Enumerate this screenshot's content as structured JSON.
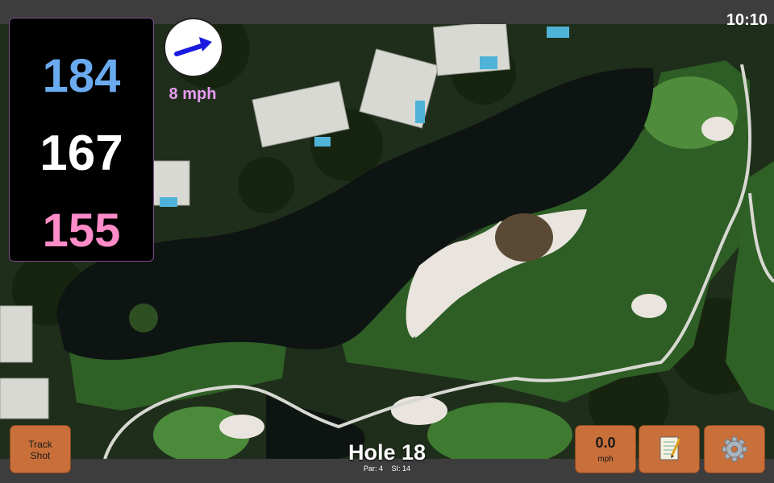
{
  "status": {
    "time": "10:10"
  },
  "distances": {
    "back": "184",
    "middle": "167",
    "front": "155"
  },
  "wind": {
    "speed_label": "8 mph",
    "direction_icon": "arrow-right-up-icon"
  },
  "hole": {
    "title": "Hole 18",
    "par": "Par: 4",
    "si": "SI: 14"
  },
  "buttons": {
    "track_line1": "Track",
    "track_line2": "Shot",
    "speed_value": "0.0",
    "speed_unit": "mph",
    "notes_icon": "notepad-icon",
    "settings_icon": "gear-icon"
  },
  "colors": {
    "back_distance": "#6aabf0",
    "middle_distance": "#ffffff",
    "front_distance": "#ff8cc8",
    "button_orange": "#c86f3a",
    "wind_text": "#e89cf5"
  }
}
